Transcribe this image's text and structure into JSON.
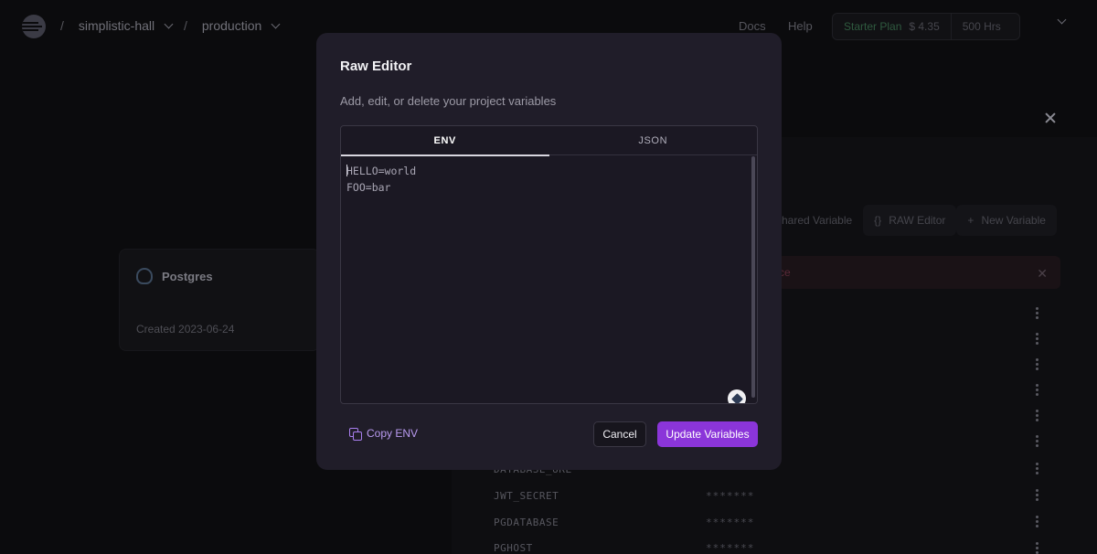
{
  "header": {
    "project": "simplistic-hall",
    "environment": "production",
    "docs_label": "Docs",
    "help_label": "Help",
    "plan_label": "Starter Plan",
    "plan_amount": "$ 4.35",
    "plan_hours": "500 Hrs"
  },
  "service_card": {
    "name": "Postgres",
    "created": "Created 2023-06-24"
  },
  "variables_panel": {
    "actions": [
      "Shared Variable",
      "RAW Editor",
      "New Variable"
    ],
    "rows": [
      {
        "name": "DATABASE_URL",
        "value": "*******"
      },
      {
        "name": "JWT_SECRET",
        "value": "*******"
      },
      {
        "name": "PGDATABASE",
        "value": "*******"
      },
      {
        "name": "PGHOST",
        "value": "*******"
      }
    ]
  },
  "modal": {
    "title": "Raw Editor",
    "subtitle": "Add, edit, or delete your project variables",
    "tabs": [
      "ENV",
      "JSON"
    ],
    "active_tab": "ENV",
    "editor_lines": [
      "HELLO=world",
      "FOO=bar"
    ],
    "copy_label": "Copy ENV",
    "cancel_label": "Cancel",
    "submit_label": "Update Variables",
    "accent_color": "#8b35d9"
  }
}
